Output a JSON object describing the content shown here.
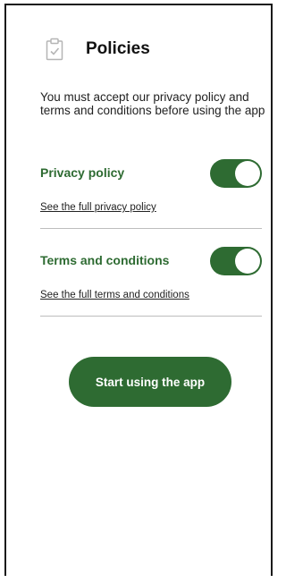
{
  "header": {
    "icon": "clipboard-check-icon",
    "title": "Policies"
  },
  "intro_text": "You must accept our privacy policy and terms and conditions before using the app",
  "policies": [
    {
      "title": "Privacy policy",
      "accepted": true,
      "link_label": "See the full privacy policy"
    },
    {
      "title": "Terms and conditions",
      "accepted": true,
      "link_label": "See the full terms and conditions"
    }
  ],
  "start_button": {
    "label": "Start using the app"
  },
  "colors": {
    "accent": "#2e6b32",
    "toggle_knob": "#ffffff",
    "divider": "#bdbdbd"
  }
}
